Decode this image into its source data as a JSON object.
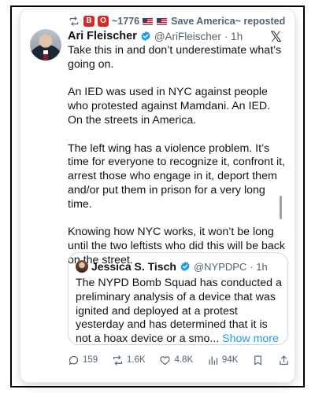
{
  "repost": {
    "badge_b": "B",
    "badge_o": "O",
    "text": "~1776🇺🇸🇺🇸Save America~ reposted",
    "text_prefix": "~1776",
    "text_suffix": "Save America~ reposted"
  },
  "tweet": {
    "author_name": "Ari Fleischer",
    "author_handle": "@AriFleischer",
    "time": "· 1h",
    "paragraphs": [
      "Take this in and don’t underestimate what’s going on.",
      "An IED was used in NYC against people who protested against Mamdani.  An IED. On the streets in America.",
      "The left wing has a violence problem.  It’s time for everyone to recognize it, confront it, arrest those who engage in it, deport them and/or put them in prison for a very long time.",
      "Knowing how NYC works, it won’t be long until the two leftists who did this will be back on the street."
    ],
    "x_logo": "𝕏"
  },
  "quote": {
    "author_name": "Jessica S. Tisch",
    "author_handle": "@NYPDPC",
    "time": "· 1h",
    "text": "The NYPD Bomb Squad has conducted a preliminary analysis of a device that was ignited and deployed at a protest yesterday and has determined that it is not a hoax device or a smo...",
    "show_more": "Show more"
  },
  "actions": {
    "replies": "159",
    "reposts": "1.6K",
    "likes": "4.8K",
    "views": "94K"
  },
  "colors": {
    "accent": "#1d9bf0",
    "muted": "#536471",
    "badge": "#d62828",
    "repost_green": "#536471"
  },
  "icons": {
    "repost": "repost-icon",
    "verified": "verified-badge-icon",
    "reply": "reply-icon",
    "like": "heart-icon",
    "views": "views-icon",
    "bookmark": "bookmark-icon",
    "share": "share-icon"
  }
}
